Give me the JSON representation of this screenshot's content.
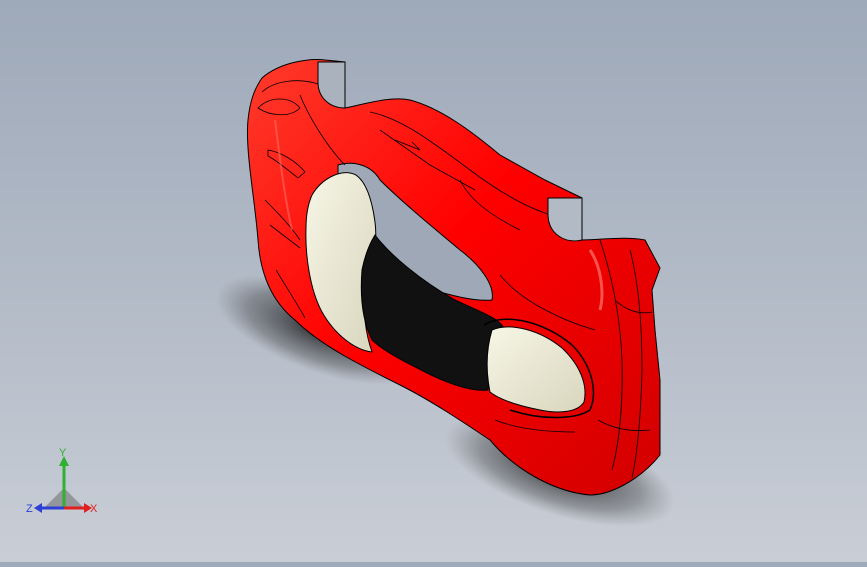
{
  "viewport": {
    "background_top": "#9ea9b9",
    "background_bottom": "#c9ced6",
    "model": {
      "description_icon": "car-body-shell-model",
      "body_color": "#ff0000",
      "body_highlight": "#ff4a3a",
      "body_shadow": "#b00000",
      "interior_color": "#111111",
      "seat_color": "#ecebd6",
      "edge_color": "#000000"
    }
  },
  "triad": {
    "x_label": "X",
    "y_label": "Y",
    "z_label": "Z",
    "x_color": "#e0201e",
    "y_color": "#2fb12f",
    "z_color": "#2c3fd6"
  }
}
